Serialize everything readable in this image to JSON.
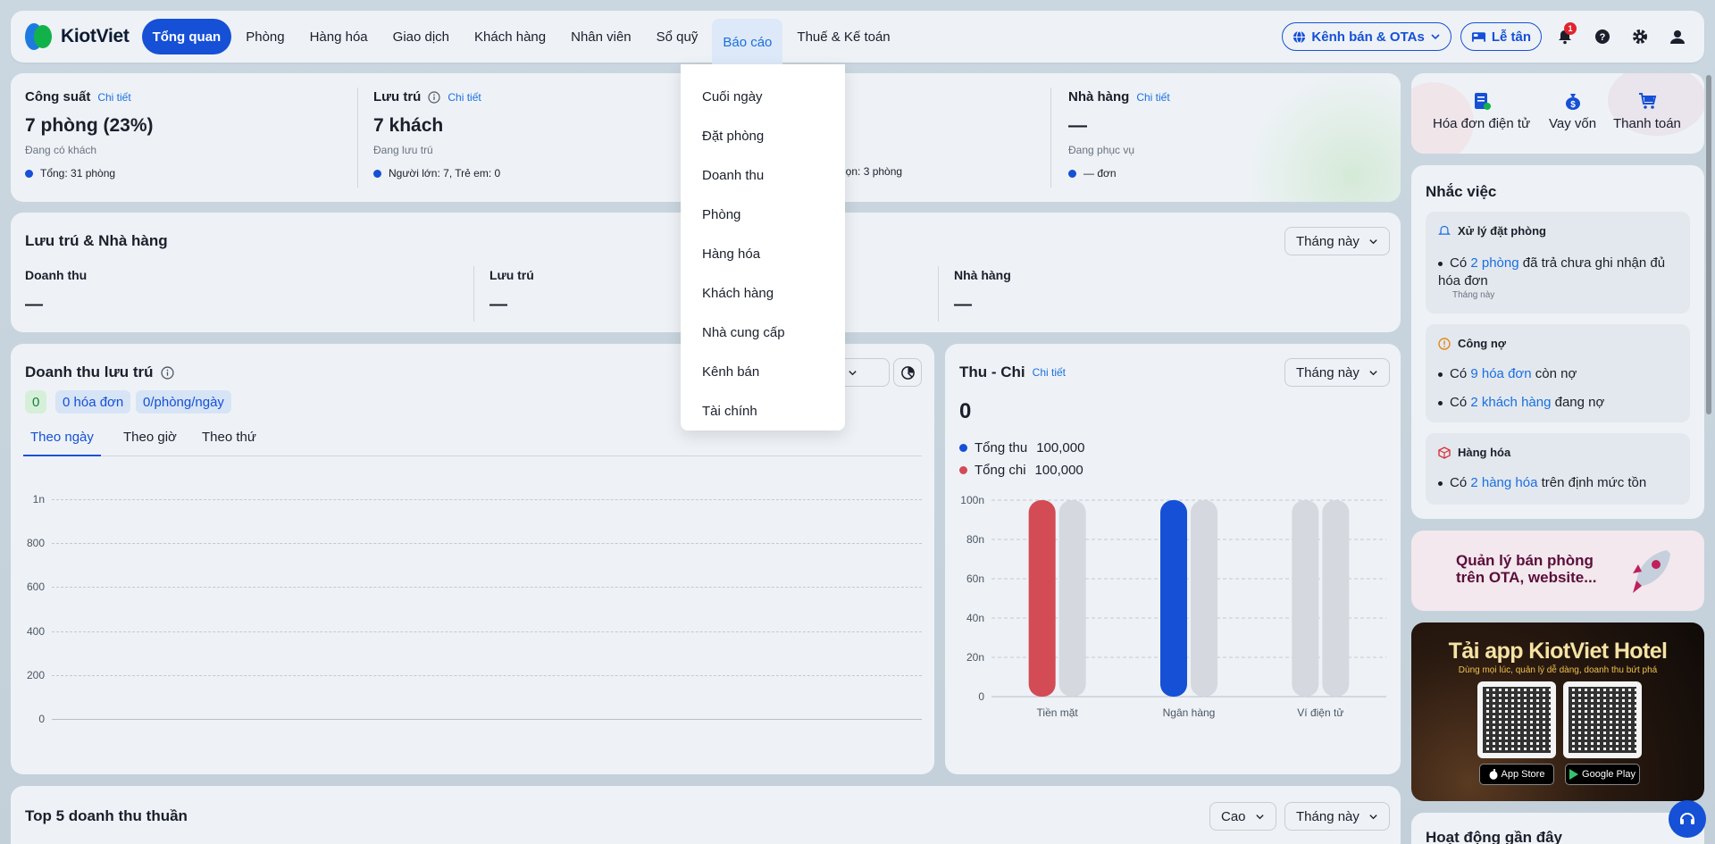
{
  "app": {
    "name": "KiotViet"
  },
  "nav": {
    "items": [
      "Tổng quan",
      "Phòng",
      "Hàng hóa",
      "Giao dịch",
      "Khách hàng",
      "Nhân viên",
      "Sổ quỹ",
      "Báo cáo",
      "Thuế & Kế toán"
    ],
    "active_index": 0,
    "open_index": 7,
    "channel_label": "Kênh bán & OTAs",
    "reception_label": "Lễ tân",
    "notification_count": "1"
  },
  "report_menu": {
    "items": [
      "Cuối ngày",
      "Đặt phòng",
      "Doanh thu",
      "Phòng",
      "Hàng hóa",
      "Khách hàng",
      "Nhà cung cấp",
      "Kênh bán",
      "Tài chính"
    ]
  },
  "stats": {
    "capacity": {
      "title": "Công suất",
      "detail": "Chi tiết",
      "value": "7 phòng (23%)",
      "sub": "Đang có khách",
      "foot_label": "Tổng:",
      "foot_value": "31 phòng"
    },
    "stay": {
      "title": "Lưu trú",
      "detail": "Chi tiết",
      "value": "7 khách",
      "sub": "Đang lưu trú",
      "foot_label": "Người lớn:",
      "foot_value": "7,",
      "foot_label2": "Trẻ em:",
      "foot_value2": "0"
    },
    "cleaning": {
      "foot_partial": "dọn:",
      "foot_value": "3 phòng"
    },
    "restaurant": {
      "title": "Nhà hàng",
      "detail": "Chi tiết",
      "value": "—",
      "sub": "Đang phục vụ",
      "foot_value": "— đơn"
    }
  },
  "stay_restaurant": {
    "title": "Lưu trú & Nhà hàng",
    "period": "Tháng này",
    "columns": [
      {
        "label": "Doanh thu",
        "value": "—"
      },
      {
        "label": "Lưu trú",
        "value": "—"
      },
      {
        "label": "Nhà hàng",
        "value": "—"
      }
    ]
  },
  "stay_revenue": {
    "title": "Doanh thu lưu trú",
    "chips": [
      "0",
      "0 hóa đơn",
      "0/phòng/ngày"
    ],
    "period_partial": "y",
    "tabs": [
      "Theo ngày",
      "Theo giờ",
      "Theo thứ"
    ],
    "active_tab": 0
  },
  "income_expense": {
    "title": "Thu - Chi",
    "detail": "Chi tiết",
    "period": "Tháng này",
    "total": "0",
    "legend": [
      {
        "name": "Tổng thu",
        "value": "100,000",
        "color": "#1550d6"
      },
      {
        "name": "Tổng chi",
        "value": "100,000",
        "color": "#d24b55"
      }
    ]
  },
  "chart_data": [
    {
      "type": "line",
      "title": "Doanh thu lưu trú",
      "y_ticks": [
        "1n",
        "800",
        "600",
        "400",
        "200",
        "0"
      ],
      "ylim": [
        0,
        1000
      ],
      "x": [],
      "series": []
    },
    {
      "type": "bar",
      "title": "Thu - Chi",
      "categories": [
        "Tiền mặt",
        "Ngân hàng",
        "Ví điện tử"
      ],
      "y_ticks": [
        "100n",
        "80n",
        "60n",
        "40n",
        "20n",
        "0"
      ],
      "ylim": [
        0,
        100000
      ],
      "series": [
        {
          "name": "Tổng thu",
          "color": "#1550d6",
          "values": [
            0,
            100000,
            0
          ]
        },
        {
          "name": "Tổng chi",
          "color": "#d24b55",
          "values": [
            100000,
            0,
            0
          ]
        }
      ]
    }
  ],
  "quick_actions": [
    "Hóa đơn điện tử",
    "Vay vốn",
    "Thanh toán"
  ],
  "reminders": {
    "title": "Nhắc việc",
    "booking": {
      "title": "Xử lý đặt phòng",
      "pre": "Có",
      "link": "2 phòng",
      "post": "đã trả chưa ghi nhận đủ hóa đơn",
      "note": "Tháng này"
    },
    "debt": {
      "title": "Công nợ",
      "line1_pre": "Có",
      "line1_link": "9 hóa đơn",
      "line1_post": "còn nợ",
      "line2_pre": "Có",
      "line2_link": "2 khách hàng",
      "line2_post": "đang nợ"
    },
    "goods": {
      "title": "Hàng hóa",
      "pre": "Có",
      "link": "2 hàng hóa",
      "post": "trên định mức tồn"
    }
  },
  "promo": {
    "line1": "Quản lý bán phòng",
    "line2": "trên OTA, website..."
  },
  "app_banner": {
    "title": "Tải app KiotViet Hotel",
    "subtitle": "Dùng mọi lúc, quản lý dễ dàng, doanh thu bứt phá",
    "app_store": "App Store",
    "google_play": "Google Play"
  },
  "top5": {
    "title": "Top 5 doanh thu thuần",
    "sort": "Cao",
    "period": "Tháng này"
  },
  "recent": {
    "title": "Hoạt động gần đây"
  }
}
